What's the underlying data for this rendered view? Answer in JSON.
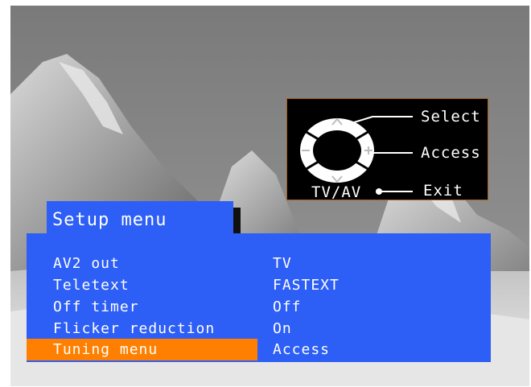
{
  "colors": {
    "panel_blue": "#2d5ef6",
    "highlight_orange": "#ff8000",
    "remote_box_border": "#a8611a"
  },
  "remote_legend": {
    "select_label": "Select",
    "access_label": "Access",
    "exit_label": "Exit",
    "tvav_label": "TV/AV"
  },
  "setup": {
    "title": "Setup menu",
    "items": [
      {
        "label": "AV2 out",
        "value": "TV",
        "selected": false
      },
      {
        "label": "Teletext",
        "value": "FASTEXT",
        "selected": false
      },
      {
        "label": "Off timer",
        "value": "Off",
        "selected": false
      },
      {
        "label": "Flicker reduction",
        "value": "On",
        "selected": false
      },
      {
        "label": "Tuning menu",
        "value": "Access",
        "selected": true
      }
    ]
  }
}
